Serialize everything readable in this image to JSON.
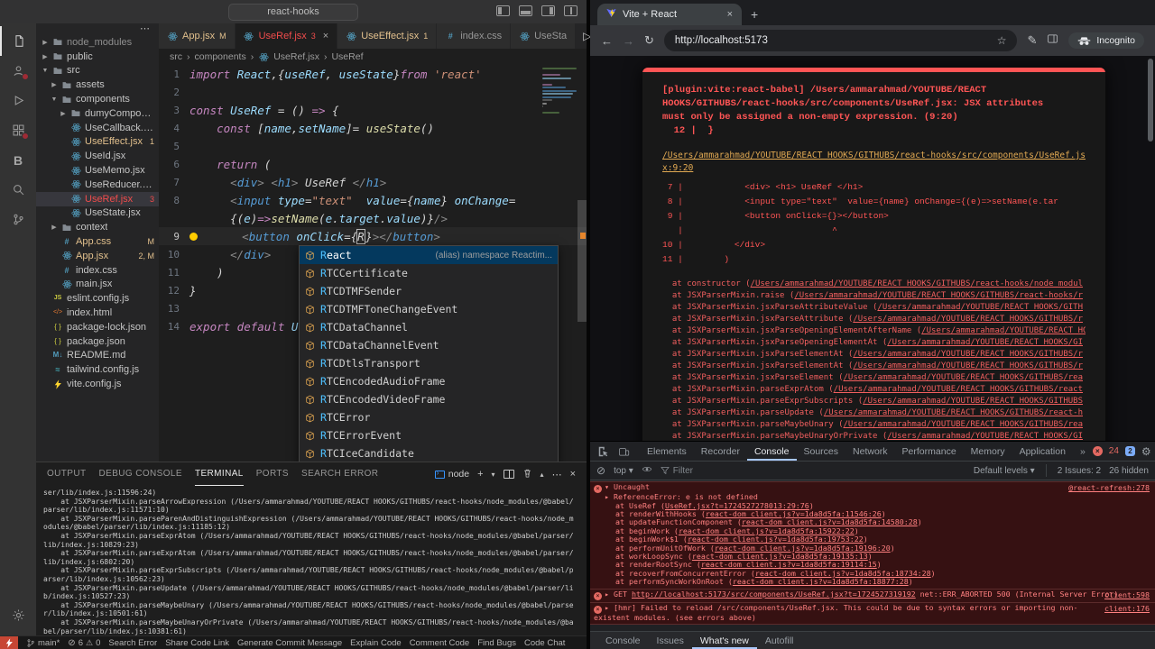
{
  "vscode": {
    "title": "react-hooks",
    "activity": [
      {
        "id": "explorer",
        "active": true
      },
      {
        "id": "accounts",
        "badge": true
      },
      {
        "id": "run-debug"
      },
      {
        "id": "extensions",
        "badge": true
      },
      {
        "id": "bito",
        "label": "B"
      },
      {
        "id": "search"
      },
      {
        "id": "source-control"
      },
      {
        "id": "settings",
        "bottom": true
      }
    ],
    "explorer_more_icon": "⋯",
    "tree": [
      {
        "label": "node_modules",
        "indent": 0,
        "kind": "folder",
        "cls": "dim"
      },
      {
        "label": "public",
        "indent": 0,
        "kind": "folder"
      },
      {
        "label": "src",
        "indent": 0,
        "kind": "folder",
        "open": true
      },
      {
        "label": "assets",
        "indent": 1,
        "kind": "folder"
      },
      {
        "label": "components",
        "indent": 1,
        "kind": "folder",
        "open": true
      },
      {
        "label": "dumyComponent",
        "indent": 2,
        "kind": "folder"
      },
      {
        "label": "UseCallback.jsx",
        "indent": 2,
        "kind": "react"
      },
      {
        "label": "UseEffect.jsx",
        "indent": 2,
        "kind": "react",
        "cls": "warn",
        "badge": "1"
      },
      {
        "label": "UseId.jsx",
        "indent": 2,
        "kind": "react"
      },
      {
        "label": "UseMemo.jsx",
        "indent": 2,
        "kind": "react"
      },
      {
        "label": "UseReducer.jsx",
        "indent": 2,
        "kind": "react"
      },
      {
        "label": "UseRef.jsx",
        "indent": 2,
        "kind": "react",
        "cls": "error",
        "badge": "3",
        "selected": true
      },
      {
        "label": "UseState.jsx",
        "indent": 2,
        "kind": "react"
      },
      {
        "label": "context",
        "indent": 1,
        "kind": "folder"
      },
      {
        "label": "App.css",
        "indent": 1,
        "kind": "css",
        "cls": "warn",
        "badge": "M"
      },
      {
        "label": "App.jsx",
        "indent": 1,
        "kind": "react",
        "cls": "warn",
        "badge": "2, M"
      },
      {
        "label": "index.css",
        "indent": 1,
        "kind": "css"
      },
      {
        "label": "main.jsx",
        "indent": 1,
        "kind": "react"
      },
      {
        "label": "eslint.config.js",
        "indent": 0,
        "kind": "js"
      },
      {
        "label": "index.html",
        "indent": 0,
        "kind": "html"
      },
      {
        "label": "package-lock.json",
        "indent": 0,
        "kind": "json"
      },
      {
        "label": "package.json",
        "indent": 0,
        "kind": "json"
      },
      {
        "label": "README.md",
        "indent": 0,
        "kind": "md"
      },
      {
        "label": "tailwind.config.js",
        "indent": 0,
        "kind": "tw"
      },
      {
        "label": "vite.config.js",
        "indent": 0,
        "kind": "vite"
      }
    ],
    "tabs": [
      {
        "label": "App.jsx",
        "kind": "react",
        "cls": "warn",
        "badge": "M"
      },
      {
        "label": "UseRef.jsx",
        "kind": "react",
        "cls": "error",
        "badge": "3",
        "active": true,
        "close": true
      },
      {
        "label": "UseEffect.jsx",
        "kind": "react",
        "cls": "warn",
        "badge": "1"
      },
      {
        "label": "index.css",
        "kind": "css"
      },
      {
        "label": "UseSta",
        "kind": "react"
      }
    ],
    "breadcrumb": [
      "src",
      "components",
      "UseRef.jsx",
      "UseRef"
    ],
    "code_rows": [
      {
        "n": "1",
        "t": [
          [
            "import ",
            "k"
          ],
          [
            "React",
            "v"
          ],
          [
            ",{",
            "p"
          ],
          [
            "useRef",
            "v"
          ],
          [
            ", ",
            "p"
          ],
          [
            "useState",
            "v"
          ],
          [
            "}",
            "p"
          ],
          [
            "from ",
            "k"
          ],
          [
            "'react'",
            "s"
          ]
        ]
      },
      {
        "n": "2",
        "t": []
      },
      {
        "n": "3",
        "t": [
          [
            "const ",
            "k"
          ],
          [
            "UseRef",
            "v"
          ],
          [
            " = () ",
            "p"
          ],
          [
            "=>",
            "k"
          ],
          [
            " {",
            "p"
          ]
        ]
      },
      {
        "n": "4",
        "t": [
          [
            "    ",
            "p"
          ],
          [
            "const ",
            "k"
          ],
          [
            "[",
            "p"
          ],
          [
            "name",
            "v"
          ],
          [
            ",",
            "p"
          ],
          [
            "setName",
            "v"
          ],
          [
            "]= ",
            "p"
          ],
          [
            "useState",
            "f"
          ],
          [
            "()",
            "p"
          ]
        ]
      },
      {
        "n": "5",
        "t": []
      },
      {
        "n": "6",
        "t": [
          [
            "    ",
            "p"
          ],
          [
            "return",
            "k"
          ],
          [
            " (",
            "p"
          ]
        ]
      },
      {
        "n": "7",
        "t": [
          [
            "      ",
            "p"
          ],
          [
            "<",
            "a"
          ],
          [
            "div",
            "tg"
          ],
          [
            "> ",
            "a"
          ],
          [
            "<",
            "a"
          ],
          [
            "h1",
            "tg"
          ],
          [
            "> ",
            "a"
          ],
          [
            "UseRef ",
            "p"
          ],
          [
            "</",
            "a"
          ],
          [
            "h1",
            "tg"
          ],
          [
            ">",
            "a"
          ]
        ]
      },
      {
        "n": "8",
        "t": [
          [
            "      ",
            "p"
          ],
          [
            "<",
            "a"
          ],
          [
            "input",
            "tg"
          ],
          [
            " ",
            "p"
          ],
          [
            "type",
            "v"
          ],
          [
            "=",
            "p"
          ],
          [
            "\"text\"",
            "s"
          ],
          [
            "  ",
            "p"
          ],
          [
            "value",
            "v"
          ],
          [
            "=",
            "p"
          ],
          [
            "{",
            "p"
          ],
          [
            "name",
            "v"
          ],
          [
            "} ",
            "p"
          ],
          [
            "onChange",
            "v"
          ],
          [
            "=",
            "p"
          ]
        ]
      },
      {
        "n": "",
        "t": [
          [
            "      {(",
            "p"
          ],
          [
            "e",
            "v"
          ],
          [
            ")",
            "p"
          ],
          [
            "=>",
            "k"
          ],
          [
            "setName",
            "f"
          ],
          [
            "(",
            "p"
          ],
          [
            "e",
            "v"
          ],
          [
            ".",
            "p"
          ],
          [
            "target",
            "v"
          ],
          [
            ".",
            "p"
          ],
          [
            "value",
            "v"
          ],
          [
            ")}",
            "p"
          ],
          [
            "/>",
            "a"
          ]
        ]
      },
      {
        "n": "9",
        "active": true,
        "t": [
          [
            "      ",
            "p"
          ],
          [
            "<",
            "a"
          ],
          [
            "button",
            "tg"
          ],
          [
            " ",
            "p"
          ],
          [
            "onClick",
            "v"
          ],
          [
            "=",
            "p"
          ],
          [
            "{",
            "p"
          ],
          [
            "R",
            "cur"
          ],
          [
            "}",
            "p"
          ],
          [
            "></",
            "a"
          ],
          [
            "button",
            "tg"
          ],
          [
            ">",
            "a"
          ]
        ]
      },
      {
        "n": "10",
        "t": [
          [
            "      ",
            "p"
          ],
          [
            "</",
            "a"
          ],
          [
            "div",
            "tg"
          ],
          [
            ">",
            "a"
          ]
        ]
      },
      {
        "n": "11",
        "t": [
          [
            "    )",
            "p"
          ]
        ]
      },
      {
        "n": "12",
        "t": [
          [
            "}",
            "p"
          ]
        ]
      },
      {
        "n": "13",
        "t": []
      },
      {
        "n": "14",
        "t": [
          [
            "export default ",
            "k"
          ],
          [
            "UseRef",
            "v"
          ]
        ]
      }
    ],
    "suggest": {
      "items": [
        {
          "label": "React",
          "selected": true,
          "detail": "(alias) namespace Reactim..."
        },
        {
          "label": "RTCCertificate"
        },
        {
          "label": "RTCDTMFSender"
        },
        {
          "label": "RTCDTMFToneChangeEvent"
        },
        {
          "label": "RTCDataChannel"
        },
        {
          "label": "RTCDataChannelEvent"
        },
        {
          "label": "RTCDtlsTransport"
        },
        {
          "label": "RTCEncodedAudioFrame"
        },
        {
          "label": "RTCEncodedVideoFrame"
        },
        {
          "label": "RTCError"
        },
        {
          "label": "RTCErrorEvent"
        },
        {
          "label": "RTCIceCandidate"
        }
      ]
    },
    "panel": {
      "tabs": [
        {
          "label": "OUTPUT"
        },
        {
          "label": "DEBUG CONSOLE"
        },
        {
          "label": "TERMINAL",
          "active": true
        },
        {
          "label": "PORTS"
        },
        {
          "label": "SEARCH ERROR"
        }
      ],
      "shell": "node",
      "terminal_lines": [
        "ser/lib/index.js:11596:24)",
        "    at JSXParserMixin.parseArrowExpression (/Users/ammarahmad/YOUTUBE/REACT HOOKS/GITHUBS/react-hooks/node_modules/@babel/",
        "parser/lib/index.js:11571:10)",
        "    at JSXParserMixin.parseParenAndDistinguishExpression (/Users/ammarahmad/YOUTUBE/REACT HOOKS/GITHUBS/react-hooks/node_m",
        "odules/@babel/parser/lib/index.js:11185:12)",
        "    at JSXParserMixin.parseExprAtom (/Users/ammarahmad/YOUTUBE/REACT HOOKS/GITHUBS/react-hooks/node_modules/@babel/parser/",
        "lib/index.js:10829:23)",
        "    at JSXParserMixin.parseExprAtom (/Users/ammarahmad/YOUTUBE/REACT HOOKS/GITHUBS/react-hooks/node_modules/@babel/parser/",
        "lib/index.js:6802:20)",
        "    at JSXParserMixin.parseExprSubscripts (/Users/ammarahmad/YOUTUBE/REACT HOOKS/GITHUBS/react-hooks/node_modules/@babel/p",
        "arser/lib/index.js:10562:23)",
        "    at JSXParserMixin.parseUpdate (/Users/ammarahmad/YOUTUBE/REACT HOOKS/GITHUBS/react-hooks/node_modules/@babel/parser/li",
        "b/index.js:10527:23)",
        "    at JSXParserMixin.parseMaybeUnary (/Users/ammarahmad/YOUTUBE/REACT HOOKS/GITHUBS/react-hooks/node_modules/@babel/parse",
        "r/lib/index.js:10501:61)",
        "    at JSXParserMixin.parseMaybeUnaryOrPrivate (/Users/ammarahmad/YOUTUBE/REACT HOOKS/GITHUBS/react-hooks/node_modules/@ba",
        "bel/parser/lib/index.js:10381:61)"
      ]
    },
    "status": {
      "branch": "main*",
      "errors": "6",
      "warnings": "0",
      "items": [
        "Search Error",
        "Share Code Link",
        "Generate Commit Message",
        "Explain Code",
        "Comment Code",
        "Find Bugs",
        "Code Chat"
      ]
    }
  },
  "browser": {
    "tab_title": "Vite + React",
    "url": "http://localhost:5173",
    "incognito": "Incognito",
    "overlay": {
      "message_lines": [
        "[plugin:vite:react-babel] /Users/ammarahmad/YOUTUBE/REACT",
        "HOOKS/GITHUBS/react-hooks/src/components/UseRef.jsx: JSX attributes",
        "must only be assigned a non-empty expression. (9:20)",
        "  12 |  }"
      ],
      "file_link": "/Users/ammarahmad/YOUTUBE/REACT HOOKS/GITHUBS/react-hooks/src/components/UseRef.jsx:9:20",
      "frame_lines": [
        " 7 |            <div> <h1> UseRef </h1>",
        " 8 |            <input type=\"text\"  value={name} onChange={(e)=>setName(e.tar",
        " 9 |            <button onClick={}></button>",
        "   |                             ^",
        "10 |          </div>",
        "11 |        )"
      ],
      "stack": [
        {
          "fn": "  at constructor (",
          "link": "/Users/ammarahmad/YOUTUBE/REACT HOOKS/GITHUBS/react-hooks/node_modul"
        },
        {
          "fn": "  at JSXParserMixin.raise (",
          "link": "/Users/ammarahmad/YOUTUBE/REACT HOOKS/GITHUBS/react-hooks/r"
        },
        {
          "fn": "  at JSXParserMixin.jsxParseAttributeValue (",
          "link": "/Users/ammarahmad/YOUTUBE/REACT HOOKS/GITH"
        },
        {
          "fn": "  at JSXParserMixin.jsxParseAttribute (",
          "link": "/Users/ammarahmad/YOUTUBE/REACT HOOKS/GITHUBS/r"
        },
        {
          "fn": "  at JSXParserMixin.jsxParseOpeningElementAfterName (",
          "link": "/Users/ammarahmad/YOUTUBE/REACT HOOKS/"
        },
        {
          "fn": "  at JSXParserMixin.jsxParseOpeningElementAt (",
          "link": "/Users/ammarahmad/YOUTUBE/REACT HOOKS/GI"
        },
        {
          "fn": "  at JSXParserMixin.jsxParseElementAt (",
          "link": "/Users/ammarahmad/YOUTUBE/REACT HOOKS/GITHUBS/r"
        },
        {
          "fn": "  at JSXParserMixin.jsxParseElementAt (",
          "link": "/Users/ammarahmad/YOUTUBE/REACT HOOKS/GITHUBS/r"
        },
        {
          "fn": "  at JSXParserMixin.jsxParseElement (",
          "link": "/Users/ammarahmad/YOUTUBE/REACT HOOKS/GITHUBS/rea"
        },
        {
          "fn": "  at JSXParserMixin.parseExprAtom (",
          "link": "/Users/ammarahmad/YOUTUBE/REACT HOOKS/GITHUBS/react"
        },
        {
          "fn": "  at JSXParserMixin.parseExprSubscripts (",
          "link": "/Users/ammarahmad/YOUTUBE/REACT HOOKS/GITHUBS"
        },
        {
          "fn": "  at JSXParserMixin.parseUpdate (",
          "link": "/Users/ammarahmad/YOUTUBE/REACT HOOKS/GITHUBS/react-h"
        },
        {
          "fn": "  at JSXParserMixin.parseMaybeUnary (",
          "link": "/Users/ammarahmad/YOUTUBE/REACT HOOKS/GITHUBS/rea"
        },
        {
          "fn": "  at JSXParserMixin.parseMaybeUnaryOrPrivate (",
          "link": "/Users/ammarahmad/YOUTUBE/REACT HOOKS/GI"
        }
      ]
    }
  },
  "devtools": {
    "tabs": [
      "Elements",
      "Recorder",
      "Console",
      "Sources",
      "Network",
      "Performance",
      "Memory",
      "Application"
    ],
    "active_tab": "Console",
    "more_tabs_icon": "»",
    "error_badge": "24",
    "issue_badge": "2",
    "toolbar": {
      "context": "top",
      "filter": "Filter",
      "levels": "Default levels",
      "issues": "2 Issues: 2",
      "hidden": "26 hidden"
    },
    "console": {
      "row1": {
        "title": "Uncaught",
        "source": "@react-refresh:278",
        "error": "ReferenceError: e is not defined",
        "stack": [
          {
            "pre": "at UseRef (",
            "link": "UseRef.jsx?t=1724527278013:29:76"
          },
          {
            "pre": "at renderWithHooks (",
            "link": "react-dom_client.js?v=1da8d5fa:11546:26"
          },
          {
            "pre": "at updateFunctionComponent (",
            "link": "react-dom_client.js?v=1da8d5fa:14580:28"
          },
          {
            "pre": "at beginWork (",
            "link": "react-dom_client.js?v=1da8d5fa:15922:22"
          },
          {
            "pre": "at beginWork$1 (",
            "link": "react-dom_client.js?v=1da8d5fa:19753:22"
          },
          {
            "pre": "at performUnitOfWork (",
            "link": "react-dom_client.js?v=1da8d5fa:19196:20"
          },
          {
            "pre": "at workLoopSync (",
            "link": "react-dom_client.js?v=1da8d5fa:19135:13"
          },
          {
            "pre": "at renderRootSync (",
            "link": "react-dom_client.js?v=1da8d5fa:19114:15"
          },
          {
            "pre": "at recoverFromConcurrentError (",
            "link": "react-dom_client.js?v=1da8d5fa:18734:28"
          },
          {
            "pre": "at performSyncWorkOnRoot (",
            "link": "react-dom_client.js?v=1da8d5fa:18877:28"
          }
        ]
      },
      "row2": {
        "pre": "GET ",
        "link": "http://localhost:5173/src/components/UseRef.jsx?t=1724527319192",
        "post": " net::ERR_ABORTED 500 (Internal Server Error)",
        "source": "client:598"
      },
      "row3": {
        "text": "[hmr] Failed to reload /src/components/UseRef.jsx. This could be due to syntax errors or importing non-existent modules. (see errors above)",
        "source": "client:176"
      }
    },
    "drawer_tabs": [
      "Console",
      "Issues",
      "What's new",
      "Autofill"
    ],
    "drawer_active": "What's new"
  }
}
